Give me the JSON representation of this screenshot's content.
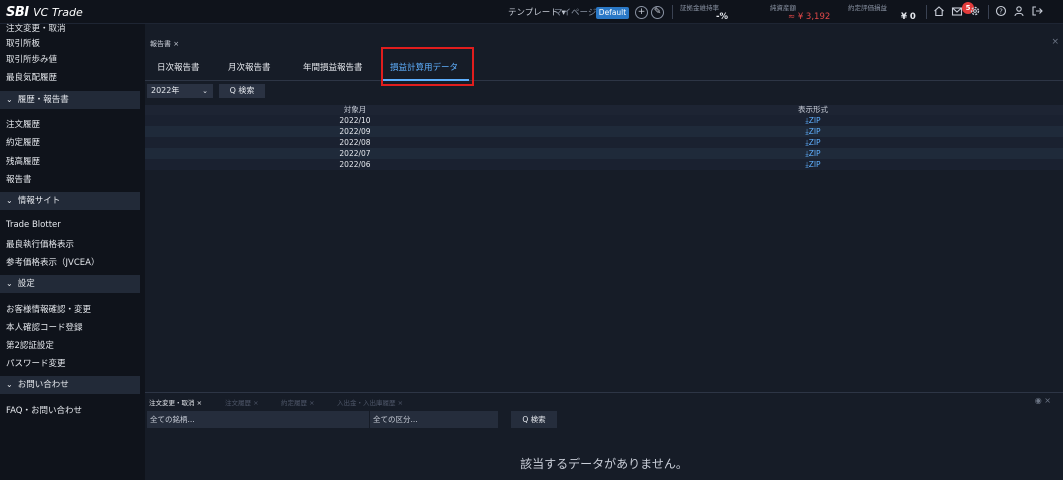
{
  "header": {
    "logo_sbi": "SBI",
    "logo_rest": "VC Trade",
    "template_label": "テンプレート ▾",
    "mypage_label": "マイページ:",
    "default_label": "Default",
    "plus_icon": "+",
    "edit_icon": "✎",
    "metrics": [
      {
        "label": "証拠金維持率",
        "value": "-%"
      },
      {
        "label": "純資産額",
        "value": "≈ ¥ 3,192"
      },
      {
        "label": "約定評価損益",
        "value": "¥ 0"
      }
    ],
    "notifications": "5"
  },
  "sidebar": {
    "top_items": [
      "注文変更・取消",
      "取引所板",
      "取引所歩み値",
      "最良気配履歴"
    ],
    "sections": [
      {
        "label": "履歴・報告書",
        "items": [
          "注文履歴",
          "約定履歴",
          "残高履歴",
          "報告書"
        ]
      },
      {
        "label": "情報サイト",
        "items": [
          "Trade Blotter",
          "最良執行価格表示",
          "参考価格表示（JVCEA）"
        ]
      },
      {
        "label": "設定",
        "items": [
          "お客様情報確認・変更",
          "本人確認コード登録",
          "第2認証設定",
          "パスワード変更"
        ]
      },
      {
        "label": "お問い合わせ",
        "items": [
          "FAQ・お問い合わせ"
        ]
      }
    ]
  },
  "main": {
    "doc_tab": "報告書 ×",
    "close": "×",
    "sub_tabs": [
      "日次報告書",
      "月次報告書",
      "年間損益報告書",
      "損益計算用データ"
    ],
    "year_value": "2022年",
    "search_label": "Q 検索",
    "table": {
      "headers": [
        "対象月",
        "表示形式"
      ],
      "rows": [
        {
          "month": "2022/10",
          "format": "⤓ZIP"
        },
        {
          "month": "2022/09",
          "format": "⤓ZIP"
        },
        {
          "month": "2022/08",
          "format": "⤓ZIP"
        },
        {
          "month": "2022/07",
          "format": "⤓ZIP"
        },
        {
          "month": "2022/06",
          "format": "⤓ZIP"
        }
      ]
    }
  },
  "bottom": {
    "tabs": [
      "注文変更・取消 ×",
      "注文履歴 ×",
      "約定履歴 ×",
      "入出金・入出庫履歴 ×"
    ],
    "brand_filter_placeholder": "全ての銘柄...",
    "category_filter_placeholder": "全ての区分...",
    "search_label": "Q 検索",
    "no_data": "該当するデータがありません。"
  },
  "colors": {
    "accent": "#5fb0ff",
    "highlight_box": "#e11d1d",
    "badge": "#2a78c6",
    "negative": "#e04848"
  }
}
